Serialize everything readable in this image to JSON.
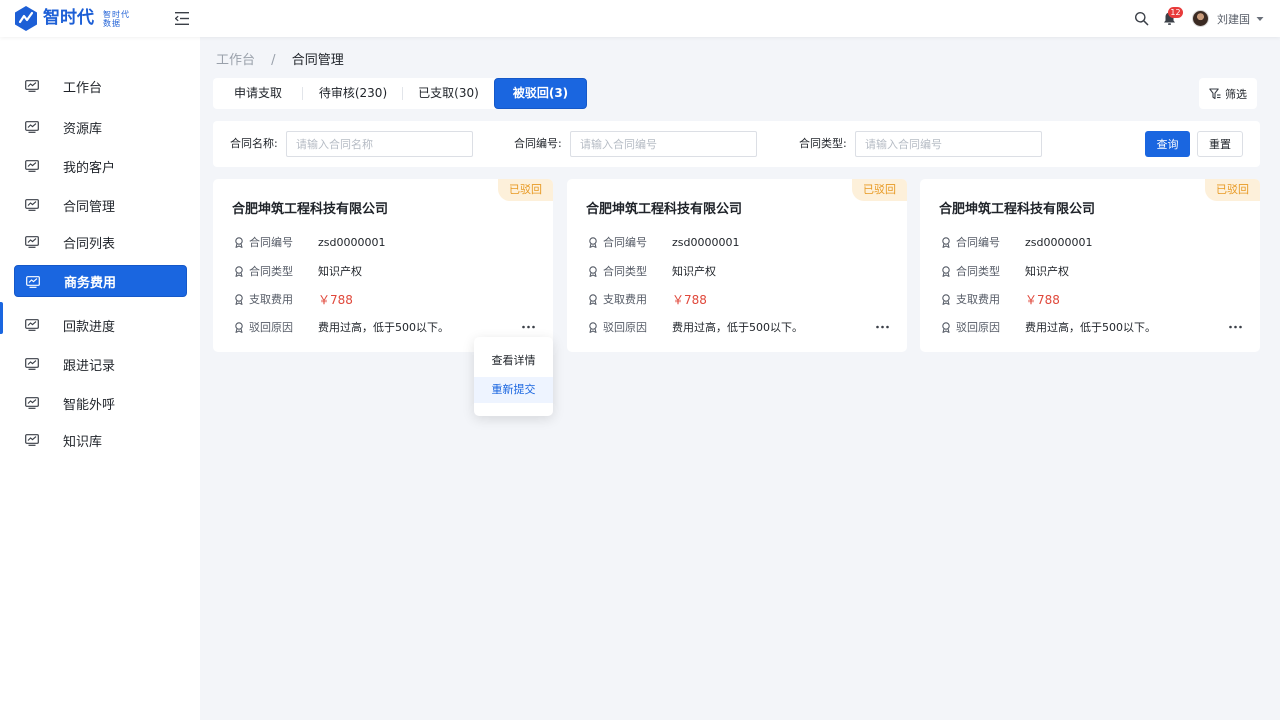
{
  "header": {
    "logo_title": "智时代",
    "logo_subtitle": "智时代数据",
    "notification_count": "12",
    "user_name": "刘建国"
  },
  "sidebar": {
    "items": [
      {
        "label": "工作台"
      },
      {
        "label": "资源库"
      },
      {
        "label": "我的客户"
      },
      {
        "label": "合同管理"
      },
      {
        "label": "合同列表"
      },
      {
        "label": "商务费用",
        "active": true
      },
      {
        "label": "回款进度"
      },
      {
        "label": "跟进记录"
      },
      {
        "label": "智能外呼"
      },
      {
        "label": "知识库"
      }
    ]
  },
  "breadcrumb": {
    "root": "工作台",
    "separator": "/",
    "current": "合同管理"
  },
  "tabs": [
    {
      "label": "申请支取"
    },
    {
      "label": "待审核(230)"
    },
    {
      "label": "已支取(30)"
    },
    {
      "label": "被驳回(3)",
      "active": true
    }
  ],
  "filter": {
    "label": "筛选"
  },
  "search": {
    "name_label": "合同名称:",
    "name_placeholder": "请输入合同名称",
    "number_label": "合同编号:",
    "number_placeholder": "请输入合同编号",
    "type_label": "合同类型:",
    "type_placeholder": "请输入合同编号",
    "query_label": "查询",
    "reset_label": "重置"
  },
  "cards": [
    {
      "badge": "已驳回",
      "title": "合肥坤筑工程科技有限公司",
      "contract_no_label": "合同编号",
      "contract_no": "zsd0000001",
      "contract_type_label": "合同类型",
      "contract_type": "知识产权",
      "fee_label": "支取费用",
      "fee": "￥788",
      "reason_label": "驳回原因",
      "reason": "费用过高，低于500以下。"
    },
    {
      "badge": "已驳回",
      "title": "合肥坤筑工程科技有限公司",
      "contract_no_label": "合同编号",
      "contract_no": "zsd0000001",
      "contract_type_label": "合同类型",
      "contract_type": "知识产权",
      "fee_label": "支取费用",
      "fee": "￥788",
      "reason_label": "驳回原因",
      "reason": "费用过高，低于500以下。"
    },
    {
      "badge": "已驳回",
      "title": "合肥坤筑工程科技有限公司",
      "contract_no_label": "合同编号",
      "contract_no": "zsd0000001",
      "contract_type_label": "合同类型",
      "contract_type": "知识产权",
      "fee_label": "支取费用",
      "fee": "￥788",
      "reason_label": "驳回原因",
      "reason": "费用过高，低于500以下。"
    }
  ],
  "dropdown": {
    "items": [
      {
        "label": "查看详情"
      },
      {
        "label": "重新提交",
        "highlighted": true
      }
    ]
  },
  "colors": {
    "primary": "#1a66e0",
    "badge_bg": "#fdf0da",
    "badge_text": "#e89a24",
    "price": "#e0483b",
    "notification": "#e83b3b"
  }
}
